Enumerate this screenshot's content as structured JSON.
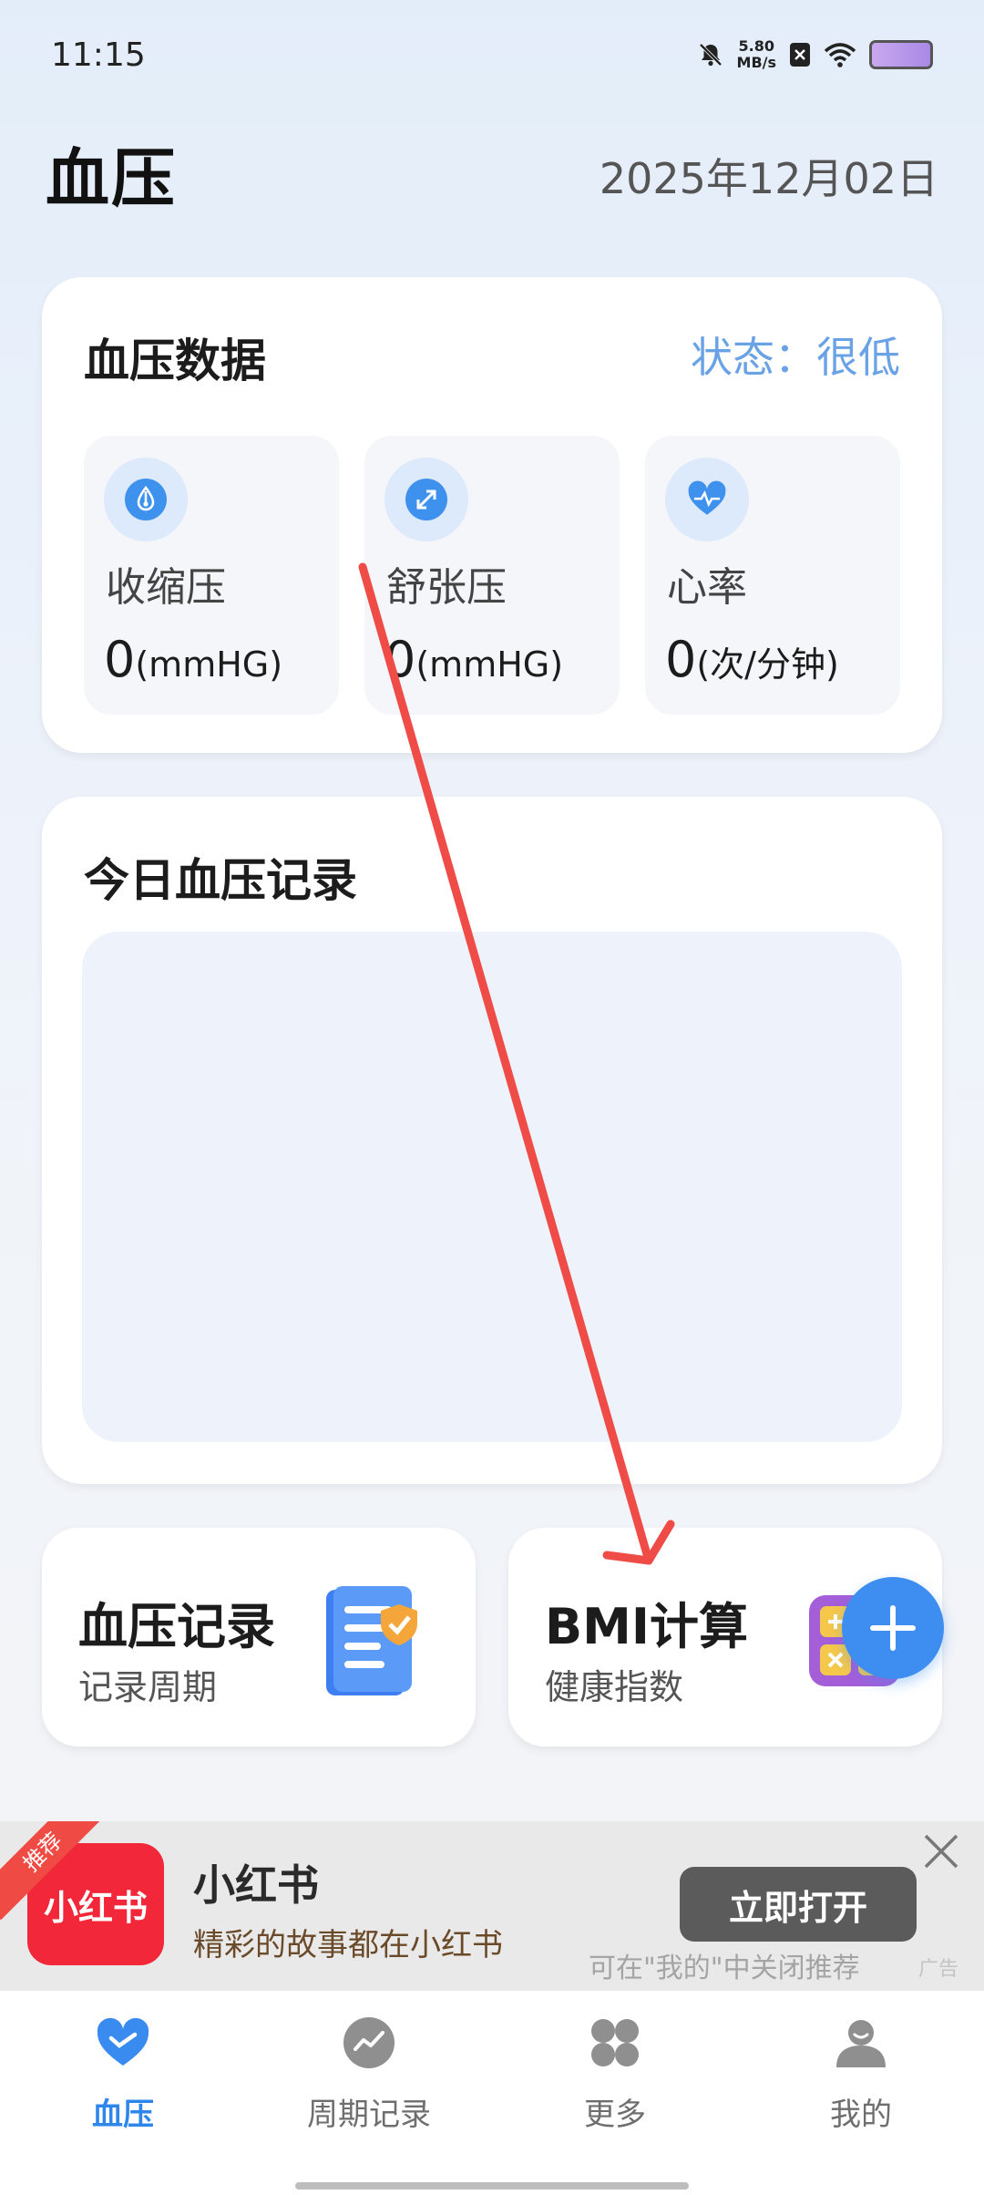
{
  "status_bar": {
    "time": "11:15",
    "net_speed_value": "5.80",
    "net_speed_unit": "MB/s"
  },
  "header": {
    "title": "血压",
    "date": "2025年12月02日"
  },
  "bp_card": {
    "title": "血压数据",
    "status": "状态：很低",
    "metrics": [
      {
        "label": "收缩压",
        "value": "0",
        "unit": "(mmHG)",
        "icon": "droplet-gauge-icon"
      },
      {
        "label": "舒张压",
        "value": "0",
        "unit": "(mmHG)",
        "icon": "expand-arrows-icon"
      },
      {
        "label": "心率",
        "value": "0",
        "unit": "(次/分钟)",
        "icon": "heart-pulse-icon"
      }
    ]
  },
  "today_card": {
    "title": "今日血压记录"
  },
  "features": [
    {
      "title": "血压记录",
      "subtitle": "记录周期",
      "icon": "document-check-icon"
    },
    {
      "title": "BMI计算",
      "subtitle": "健康指数",
      "icon": "calculator-icon"
    }
  ],
  "ad": {
    "badge": "推荐",
    "logo_text": "小红书",
    "title": "小红书",
    "description": "精彩的故事都在小红书",
    "button": "立即打开",
    "close_hint": "可在\"我的\"中关闭推荐",
    "tag": "广告"
  },
  "nav": {
    "items": [
      {
        "label": "血压",
        "icon": "heart-icon",
        "active": true
      },
      {
        "label": "周期记录",
        "icon": "trend-icon",
        "active": false
      },
      {
        "label": "更多",
        "icon": "grid-icon",
        "active": false
      },
      {
        "label": "我的",
        "icon": "user-icon",
        "active": false
      }
    ]
  },
  "colors": {
    "accent": "#3d8ef0",
    "status_text": "#6aa2e6",
    "annotation_arrow": "#ef4b47",
    "ad_logo": "#f2283a"
  }
}
